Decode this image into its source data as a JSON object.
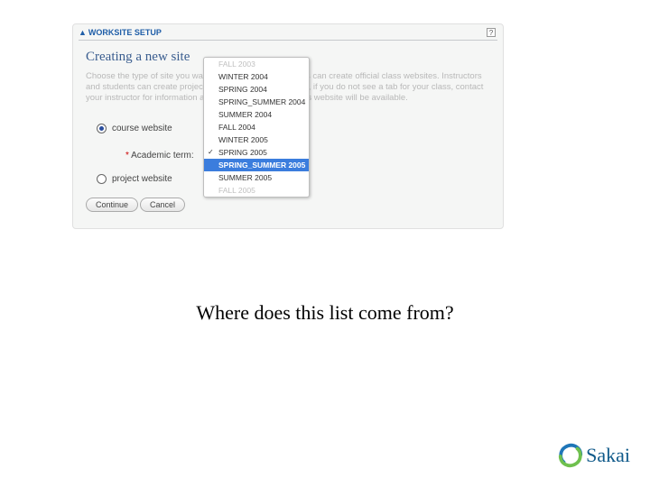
{
  "panel": {
    "breadcrumb": "WORKSITE SETUP",
    "help": "?",
    "heading": "Creating a new site",
    "blurb": "Choose the type of site you want to create. Only instructors can create official class websites. Instructors and students can create project websites. NOTE: Students, if you do not see a tab for your class, contact your instructor for information about when your official class website will be available."
  },
  "radios": {
    "course": "course website",
    "project": "project website"
  },
  "term": {
    "label": "Academic term:"
  },
  "buttons": {
    "continue": "Continue",
    "cancel": "Cancel"
  },
  "dropdown": {
    "options": [
      {
        "label": "FALL 2003",
        "dim": true
      },
      {
        "label": "WINTER 2004"
      },
      {
        "label": "SPRING 2004"
      },
      {
        "label": "SPRING_SUMMER 2004"
      },
      {
        "label": "SUMMER 2004"
      },
      {
        "label": "FALL 2004"
      },
      {
        "label": "WINTER 2005"
      },
      {
        "label": "SPRING 2005",
        "checked": true
      },
      {
        "label": "SPRING_SUMMER 2005",
        "selected": true
      },
      {
        "label": "SUMMER 2005"
      },
      {
        "label": "FALL 2005",
        "dim": true
      }
    ]
  },
  "caption": "Where does this list come from?",
  "logo": {
    "word": "Sakai"
  }
}
